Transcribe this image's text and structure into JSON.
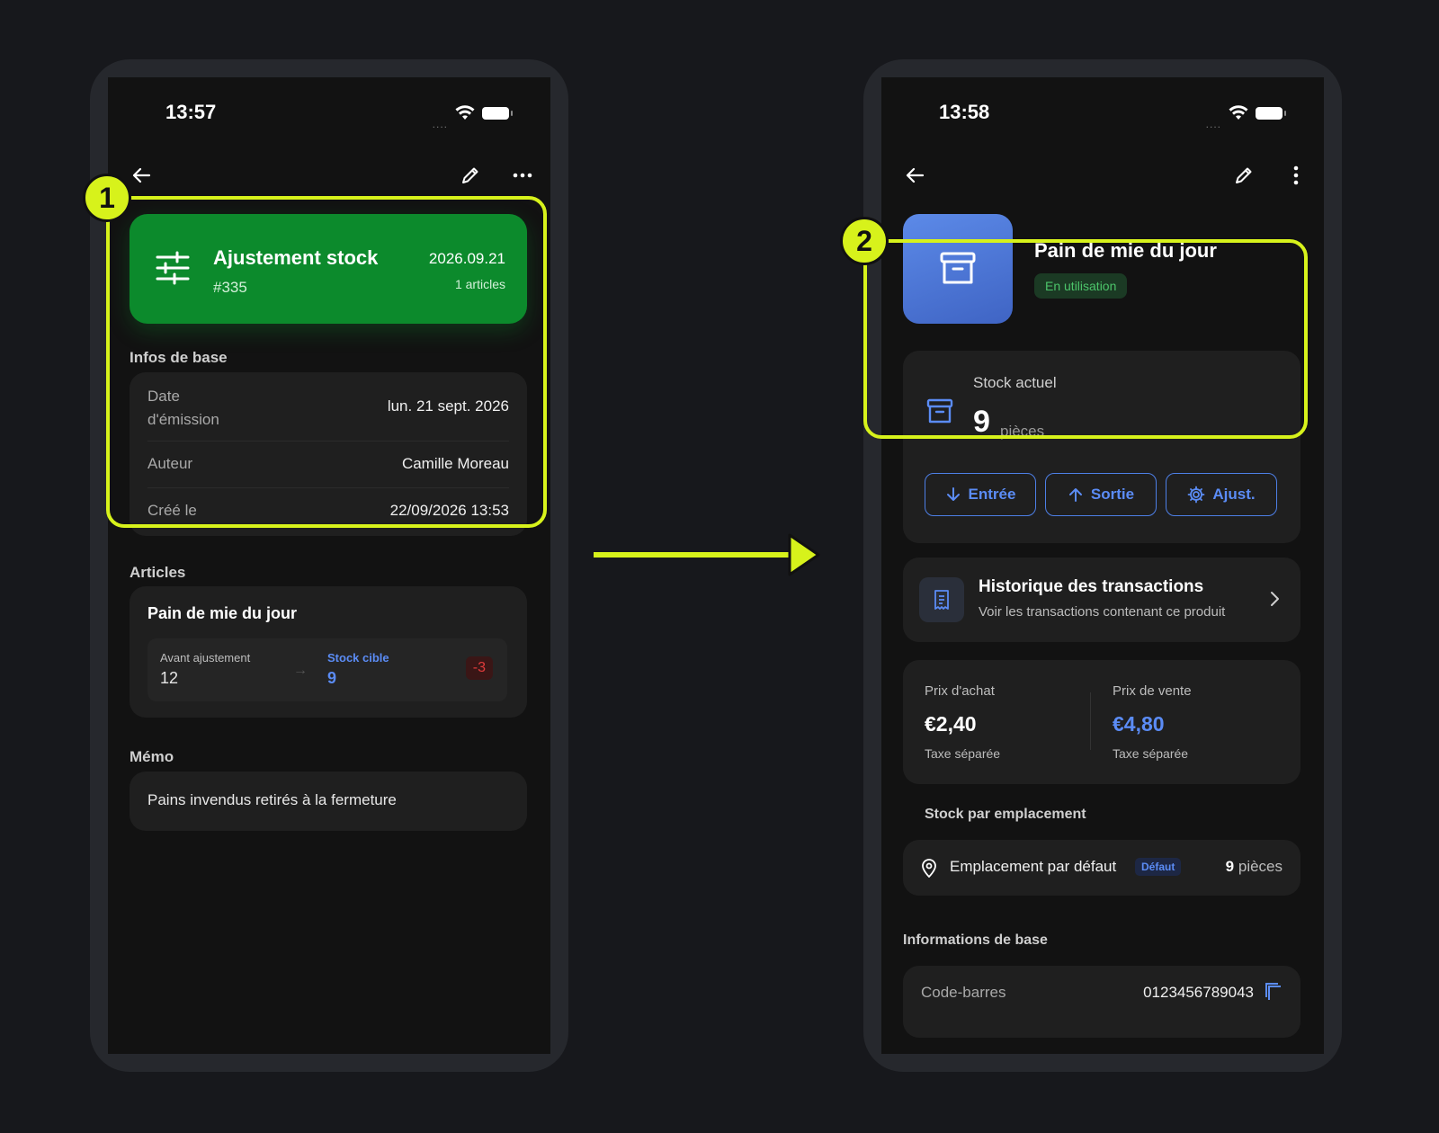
{
  "left": {
    "time": "13:57",
    "signal": "....",
    "card": {
      "title": "Ajustement stock",
      "number": "#335",
      "date": "2026.09.21",
      "count": "1 articles"
    },
    "basic_title": "Infos de base",
    "info_rows": [
      {
        "key": "Date\nd'émission",
        "value": "lun. 21 sept. 2026"
      },
      {
        "key": "Auteur",
        "value": "Camille Moreau"
      },
      {
        "key": "Créé le",
        "value": "22/09/2026 13:53"
      }
    ],
    "articles_title": "Articles",
    "article": {
      "name": "Pain de mie du jour",
      "before_label": "Avant ajustement",
      "before_value": "12",
      "target_label": "Stock cible",
      "target_value": "9",
      "diff": "-3"
    },
    "memo_title": "Mémo",
    "memo_text": "Pains invendus retirés à la fermeture"
  },
  "right": {
    "time": "13:58",
    "signal": "....",
    "product_title": "Pain de mie du jour",
    "status": "En utilisation",
    "stock_label": "Stock actuel",
    "stock_value": "9",
    "stock_unit": "pièces",
    "buttons": {
      "in": "Entrée",
      "out": "Sortie",
      "adjust": "Ajust."
    },
    "history": {
      "title": "Historique des transactions",
      "subtitle": "Voir les transactions contenant ce produit"
    },
    "purchase": {
      "label": "Prix d'achat",
      "value": "€2,40",
      "tax": "Taxe séparée"
    },
    "sale": {
      "label": "Prix de vente",
      "value": "€4,80",
      "tax": "Taxe séparée"
    },
    "location_title": "Stock par emplacement",
    "location": {
      "name": "Emplacement par défaut",
      "badge": "Défaut",
      "qty": "9",
      "unit": "pièces"
    },
    "basic_title": "Informations de base",
    "barcode": {
      "label": "Code-barres",
      "value": "0123456789043"
    }
  },
  "annotations": {
    "badge1": "1",
    "badge2": "2"
  },
  "colors": {
    "accent": "#d7f21b",
    "green": "#0c8a2c",
    "blue": "#5b8cf5",
    "red": "#e03b3b"
  }
}
